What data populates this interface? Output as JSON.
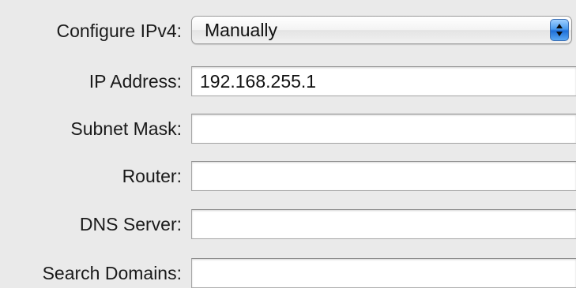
{
  "configure": {
    "label": "Configure IPv4:",
    "selected": "Manually",
    "icon": "up-down-arrows-icon",
    "accent_color": "#3d8ae8"
  },
  "fields": {
    "ip_address": {
      "label": "IP Address:",
      "value": "192.168.255.1"
    },
    "subnet_mask": {
      "label": "Subnet Mask:",
      "value": ""
    },
    "router": {
      "label": "Router:",
      "value": ""
    },
    "dns_server": {
      "label": "DNS Server:",
      "value": ""
    },
    "search_domains": {
      "label": "Search Domains:",
      "value": ""
    }
  }
}
